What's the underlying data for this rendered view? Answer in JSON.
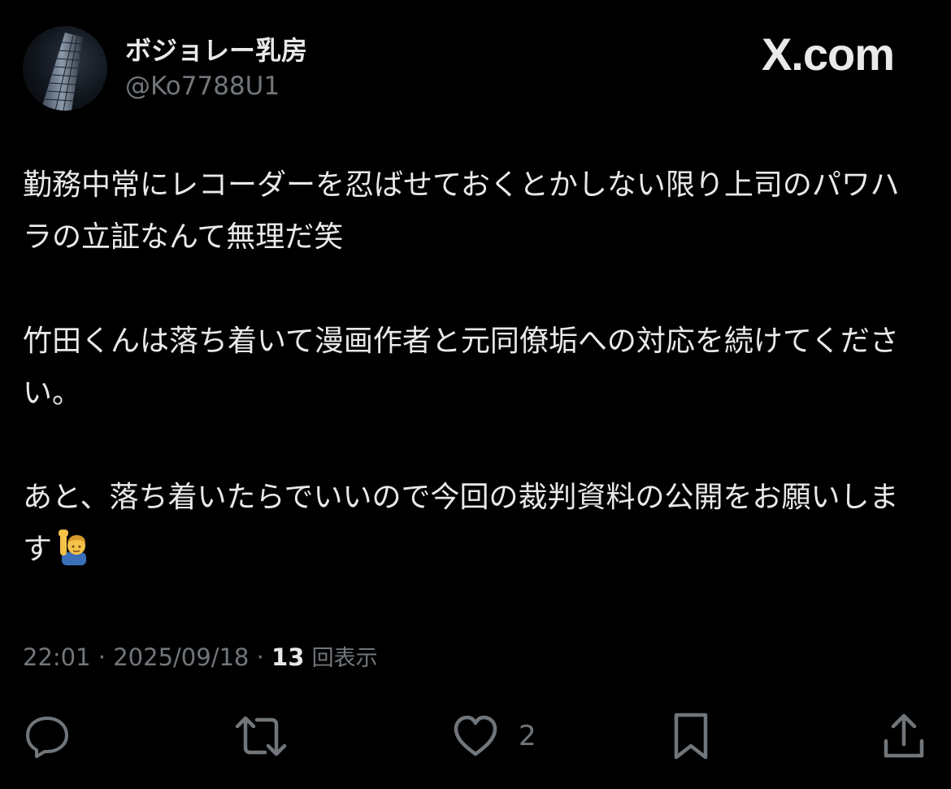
{
  "header": {
    "display_name": "ボジョレー乳房",
    "handle": "@Ko7788U1",
    "brand": "X.com"
  },
  "tweet": {
    "paragraphs": [
      "勤務中常にレコーダーを忍ばせておくとかしない限り上司のパワハラの立証なんて無理だ笑",
      "竹田くんは落ち着いて漫画作者と元同僚垢への対応を続けてください。",
      "あと、落ち着いたらでいいので今回の裁判資料の公開をお願いします"
    ],
    "emoji": "man-raising-hand-emoji"
  },
  "meta": {
    "time": "22:01",
    "separator": "·",
    "date": "2025/09/18",
    "views_count": "13",
    "views_label": "回表示"
  },
  "actions": {
    "reply": {
      "icon": "reply-icon"
    },
    "repost": {
      "icon": "repost-icon"
    },
    "like": {
      "icon": "heart-icon",
      "count": "2"
    },
    "bookmark": {
      "icon": "bookmark-icon"
    },
    "share": {
      "icon": "share-icon"
    }
  },
  "colors": {
    "background": "#000000",
    "text": "#e7e9ea",
    "muted": "#71767b"
  }
}
